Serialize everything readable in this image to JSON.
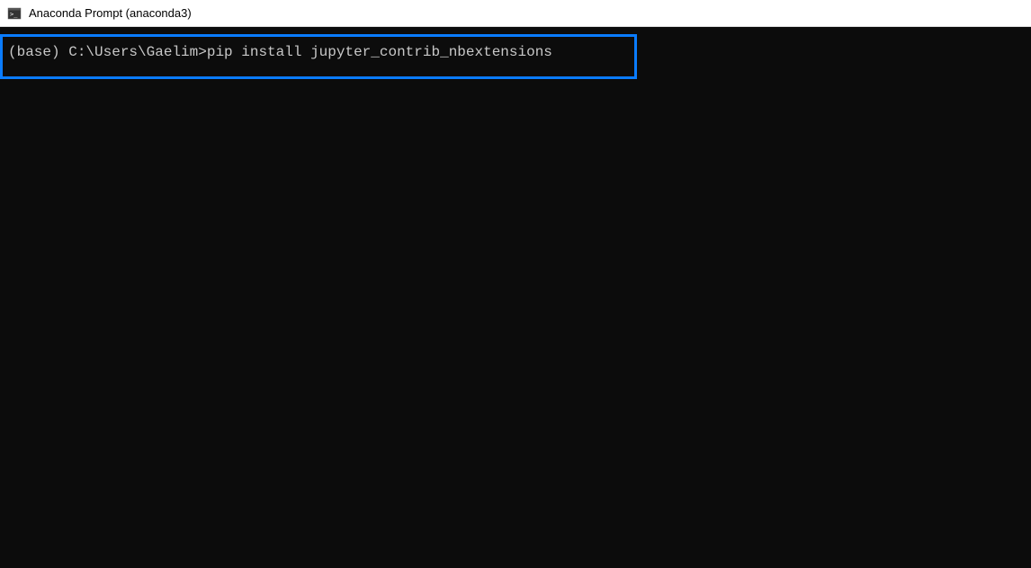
{
  "window": {
    "title": "Anaconda Prompt (anaconda3)"
  },
  "terminal": {
    "prompt": "(base) C:\\Users\\Gaelim>",
    "command": "pip install jupyter_contrib_nbextensions"
  },
  "colors": {
    "highlight_border": "#0a7cff",
    "terminal_bg": "#0c0c0c",
    "terminal_fg": "#c8c8c8"
  }
}
